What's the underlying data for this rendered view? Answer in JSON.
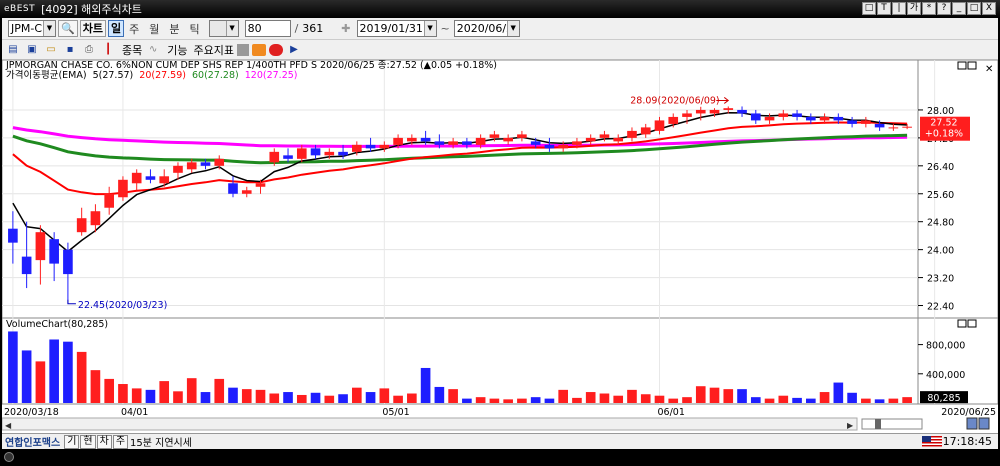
{
  "window": {
    "app_logo": "eBEST",
    "title": "[4092] 해외주식차트",
    "buttons": [
      "□",
      "T",
      "|",
      "가",
      "*",
      "?",
      "_",
      "□",
      "X"
    ]
  },
  "toolbar": {
    "symbol": "JPM-C",
    "chart_button": "차트",
    "period_buttons": [
      "일",
      "주",
      "월",
      "분",
      "틱"
    ],
    "active_period": "일",
    "count_value": "80",
    "count_separator": "/",
    "count_total": "361",
    "start_date": "2019/01/31",
    "date_separator": "~",
    "end_date": "2020/06/25"
  },
  "toolbar2": {
    "menu_items": [
      "종목",
      "기능",
      "주요지표"
    ]
  },
  "chart": {
    "price_title": "JPMORGAN CHASE  CO. 6%NON CUM DEP SHS REP 1/400TH PFD S  2020/06/25 종:27.52  (▲0.05 +0.18%)",
    "ema_legend_prefix": "가격이동평균(EMA)",
    "ema_legend_5": "5(27.57)",
    "ema_legend_20": "20(27.59)",
    "ema_legend_60": "60(27.28)",
    "ema_legend_120": "120(27.25)",
    "high_annotation": "28.09(2020/06/09)",
    "low_annotation": "22.45(2020/03/23)",
    "last_price": "27.52",
    "last_change": "+0.18%",
    "volume_title": "VolumeChart(80,285)",
    "volume_last": "80,285",
    "colors": {
      "up": "#ff1e1e",
      "down": "#1e1eff",
      "ema5": "#000000",
      "ema20": "#ff0000",
      "ema60": "#1f8a1f",
      "ema120": "#ff00ff"
    }
  },
  "chart_data": {
    "type": "candlestick",
    "price_axis": {
      "ticks": [
        "28.00",
        "27.20",
        "26.40",
        "25.60",
        "24.80",
        "24.00",
        "23.20",
        "22.40"
      ],
      "ylim": [
        22.1,
        28.8
      ]
    },
    "volume_axis": {
      "ticks": [
        "800,000",
        "400,000"
      ],
      "ylim": [
        0,
        1000000
      ]
    },
    "x_labels": [
      {
        "index": 0,
        "label": "2020/03/18"
      },
      {
        "index": 8,
        "label": "04/01"
      },
      {
        "index": 27,
        "label": "05/01"
      },
      {
        "index": 47,
        "label": "06/01"
      },
      {
        "index": 67,
        "label": "2020/06/25"
      }
    ],
    "candles": [
      [
        24.6,
        25.1,
        23.6,
        24.2,
        980000
      ],
      [
        23.8,
        24.8,
        22.9,
        23.3,
        720000
      ],
      [
        23.7,
        24.7,
        23.0,
        24.5,
        570000
      ],
      [
        24.3,
        24.5,
        23.1,
        23.6,
        870000
      ],
      [
        24.0,
        24.2,
        22.45,
        23.3,
        840000
      ],
      [
        24.5,
        25.2,
        24.4,
        24.9,
        700000
      ],
      [
        24.7,
        25.3,
        24.5,
        25.1,
        450000
      ],
      [
        25.2,
        25.8,
        25.0,
        25.6,
        330000
      ],
      [
        25.5,
        26.1,
        25.4,
        26.0,
        260000
      ],
      [
        25.9,
        26.3,
        25.7,
        26.2,
        200000
      ],
      [
        26.1,
        26.3,
        25.9,
        26.0,
        180000
      ],
      [
        25.9,
        26.3,
        25.8,
        26.1,
        300000
      ],
      [
        26.2,
        26.5,
        26.0,
        26.4,
        160000
      ],
      [
        26.3,
        26.6,
        26.2,
        26.5,
        340000
      ],
      [
        26.5,
        26.6,
        26.3,
        26.4,
        150000
      ],
      [
        26.4,
        26.7,
        26.3,
        26.6,
        330000
      ],
      [
        25.9,
        26.1,
        25.5,
        25.6,
        210000
      ],
      [
        25.6,
        25.8,
        25.5,
        25.7,
        190000
      ],
      [
        25.8,
        26.0,
        25.6,
        25.9,
        180000
      ],
      [
        26.5,
        26.9,
        26.4,
        26.8,
        130000
      ],
      [
        26.7,
        26.9,
        26.5,
        26.6,
        150000
      ],
      [
        26.6,
        27.0,
        26.5,
        26.9,
        110000
      ],
      [
        26.9,
        27.0,
        26.6,
        26.7,
        140000
      ],
      [
        26.7,
        26.9,
        26.6,
        26.8,
        100000
      ],
      [
        26.8,
        27.0,
        26.6,
        26.7,
        120000
      ],
      [
        26.8,
        27.1,
        26.7,
        27.0,
        210000
      ],
      [
        27.0,
        27.2,
        26.8,
        26.9,
        150000
      ],
      [
        26.9,
        27.1,
        26.8,
        27.0,
        200000
      ],
      [
        27.0,
        27.3,
        26.9,
        27.2,
        100000
      ],
      [
        27.1,
        27.3,
        27.0,
        27.2,
        130000
      ],
      [
        27.2,
        27.4,
        27.0,
        27.1,
        480000
      ],
      [
        27.1,
        27.3,
        26.9,
        27.0,
        220000
      ],
      [
        27.0,
        27.2,
        26.9,
        27.1,
        190000
      ],
      [
        27.1,
        27.2,
        26.9,
        27.0,
        60000
      ],
      [
        27.0,
        27.3,
        26.9,
        27.2,
        80000
      ],
      [
        27.2,
        27.4,
        27.1,
        27.3,
        60000
      ],
      [
        27.1,
        27.3,
        27.0,
        27.2,
        50000
      ],
      [
        27.2,
        27.4,
        27.1,
        27.3,
        60000
      ],
      [
        27.1,
        27.2,
        26.9,
        27.0,
        80000
      ],
      [
        27.0,
        27.2,
        26.8,
        26.9,
        60000
      ],
      [
        26.9,
        27.1,
        26.8,
        27.0,
        180000
      ],
      [
        27.0,
        27.2,
        26.9,
        27.1,
        70000
      ],
      [
        27.1,
        27.3,
        27.0,
        27.2,
        150000
      ],
      [
        27.2,
        27.4,
        27.1,
        27.3,
        130000
      ],
      [
        27.1,
        27.3,
        27.0,
        27.2,
        100000
      ],
      [
        27.2,
        27.5,
        27.1,
        27.4,
        180000
      ],
      [
        27.3,
        27.6,
        27.2,
        27.5,
        120000
      ],
      [
        27.4,
        27.8,
        27.3,
        27.7,
        100000
      ],
      [
        27.6,
        27.9,
        27.5,
        27.8,
        60000
      ],
      [
        27.8,
        28.0,
        27.6,
        27.9,
        80000
      ],
      [
        27.9,
        28.09,
        27.7,
        28.0,
        230000
      ],
      [
        27.9,
        28.05,
        27.8,
        28.0,
        210000
      ],
      [
        28.0,
        28.1,
        27.9,
        28.05,
        190000
      ],
      [
        28.0,
        28.1,
        27.8,
        27.9,
        190000
      ],
      [
        27.9,
        28.0,
        27.6,
        27.7,
        80000
      ],
      [
        27.7,
        27.9,
        27.6,
        27.8,
        60000
      ],
      [
        27.8,
        28.0,
        27.7,
        27.9,
        100000
      ],
      [
        27.9,
        28.0,
        27.7,
        27.8,
        70000
      ],
      [
        27.8,
        27.9,
        27.6,
        27.7,
        60000
      ],
      [
        27.7,
        27.9,
        27.6,
        27.8,
        150000
      ],
      [
        27.8,
        27.9,
        27.6,
        27.7,
        280000
      ],
      [
        27.7,
        27.8,
        27.5,
        27.6,
        140000
      ],
      [
        27.6,
        27.8,
        27.5,
        27.7,
        60000
      ],
      [
        27.6,
        27.7,
        27.4,
        27.5,
        50000
      ],
      [
        27.5,
        27.6,
        27.4,
        27.5,
        60000
      ],
      [
        27.5,
        27.6,
        27.45,
        27.52,
        80285
      ]
    ]
  },
  "bottombar": {
    "provider_logo": "연합인포맥스",
    "buttons": [
      "기",
      "현",
      "차",
      "주"
    ],
    "delay_text": "15분 지연시세",
    "clock": "17:18:45"
  }
}
